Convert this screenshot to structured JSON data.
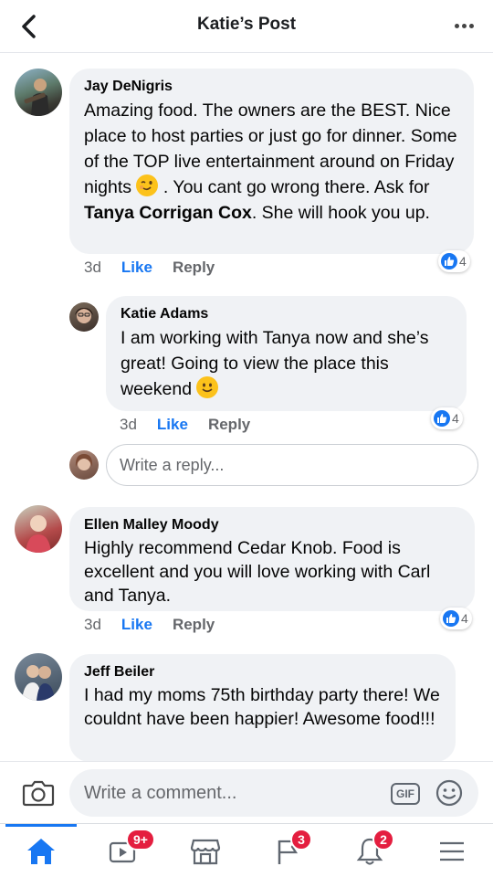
{
  "header": {
    "title": "Katie’s Post"
  },
  "comments": [
    {
      "author": "Jay DeNigris",
      "text_parts": [
        "Amazing food.  The owners are the BEST. Nice place to host parties or just go for dinner.  Some of the TOP live entertainment around on Friday nights ",
        " .  You cant go wrong there.  Ask for ",
        "Tanya Corrigan Cox",
        ". She will hook you up."
      ],
      "time": "3d",
      "like": "Like",
      "reply": "Reply",
      "reactions": "4"
    },
    {
      "author": "Katie Adams",
      "text_parts": [
        "I am working with Tanya now and she’s great! Going to view the place this weekend "
      ],
      "time": "3d",
      "like": "Like",
      "reply": "Reply",
      "reactions": "4"
    },
    {
      "author": "Ellen Malley Moody",
      "text_parts": [
        "Highly recommend Cedar Knob.  Food is excellent and you will love working with Carl and Tanya."
      ],
      "time": "3d",
      "like": "Like",
      "reply": "Reply",
      "reactions": "4"
    },
    {
      "author": "Jeff Beiler",
      "text_parts": [
        "I had my moms 75th birthday party there! We couldnt have been happier! Awesome food!!!"
      ]
    }
  ],
  "reply_box": {
    "placeholder": "Write a reply..."
  },
  "composer": {
    "placeholder": "Write a comment...",
    "gif_label": "GIF"
  },
  "nav": {
    "items": [
      {
        "name": "home",
        "badge": ""
      },
      {
        "name": "watch",
        "badge": "9+"
      },
      {
        "name": "marketplace",
        "badge": ""
      },
      {
        "name": "pages",
        "badge": "3"
      },
      {
        "name": "notifications",
        "badge": "2"
      },
      {
        "name": "menu",
        "badge": ""
      }
    ]
  },
  "colors": {
    "accent": "#1877f2",
    "badge": "#e41e3f",
    "bubble": "#f0f2f5",
    "muted_text": "#65676b"
  },
  "icons": [
    "back-arrow-icon",
    "more-icon",
    "wink-emoji-icon",
    "smile-emoji-icon",
    "thumbs-up-icon",
    "camera-icon",
    "gif-icon",
    "sticker-icon",
    "home-icon",
    "watch-icon",
    "marketplace-icon",
    "pages-flag-icon",
    "bell-icon",
    "hamburger-menu-icon"
  ]
}
